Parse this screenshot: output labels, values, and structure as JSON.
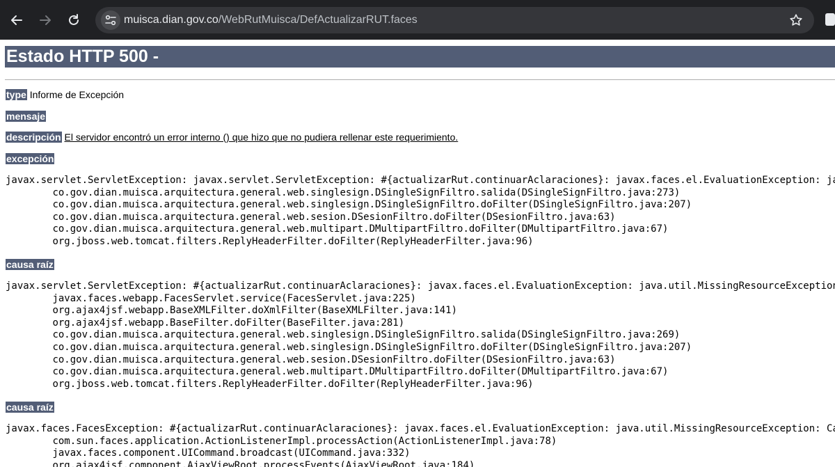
{
  "browser": {
    "url_host": "muisca.dian.gov.co",
    "url_path": "/WebRutMuisca/DefActualizarRUT.faces",
    "icons": {
      "back": "arrow-left-icon",
      "forward": "arrow-right-icon",
      "reload": "reload-icon",
      "site_info": "tune-icon",
      "bookmark": "star-icon"
    }
  },
  "page": {
    "title": "Estado HTTP 500 -",
    "type_label": "type",
    "type_value": "Informe de Excepción",
    "message_label": "mensaje",
    "description_label": "descripción",
    "description_value": "El servidor encontró un error interno () que hizo que no pudiera rellenar este requerimiento.",
    "exception_label": "excepción",
    "exception_trace": "javax.servlet.ServletException: javax.servlet.ServletException: #{actualizarRut.continuarAclaraciones}: javax.faces.el.EvaluationException: java.u\n\tco.gov.dian.muisca.arquitectura.general.web.singlesign.DSingleSignFiltro.salida(DSingleSignFiltro.java:273)\n\tco.gov.dian.muisca.arquitectura.general.web.singlesign.DSingleSignFiltro.doFilter(DSingleSignFiltro.java:207)\n\tco.gov.dian.muisca.arquitectura.general.web.sesion.DSesionFiltro.doFilter(DSesionFiltro.java:63)\n\tco.gov.dian.muisca.arquitectura.general.web.multipart.DMultipartFiltro.doFilter(DMultipartFiltro.java:67)\n\torg.jboss.web.tomcat.filters.ReplyHeaderFilter.doFilter(ReplyHeaderFilter.java:96)",
    "root_cause_label": "causa raíz",
    "root_cause_trace_1": "javax.servlet.ServletException: #{actualizarRut.continuarAclaraciones}: javax.faces.el.EvaluationException: java.util.MissingResourceException: Ca\n\tjavax.faces.webapp.FacesServlet.service(FacesServlet.java:225)\n\torg.ajax4jsf.webapp.BaseXMLFilter.doXmlFilter(BaseXMLFilter.java:141)\n\torg.ajax4jsf.webapp.BaseFilter.doFilter(BaseFilter.java:281)\n\tco.gov.dian.muisca.arquitectura.general.web.singlesign.DSingleSignFiltro.salida(DSingleSignFiltro.java:269)\n\tco.gov.dian.muisca.arquitectura.general.web.singlesign.DSingleSignFiltro.doFilter(DSingleSignFiltro.java:207)\n\tco.gov.dian.muisca.arquitectura.general.web.sesion.DSesionFiltro.doFilter(DSesionFiltro.java:63)\n\tco.gov.dian.muisca.arquitectura.general.web.multipart.DMultipartFiltro.doFilter(DMultipartFiltro.java:67)\n\torg.jboss.web.tomcat.filters.ReplyHeaderFilter.doFilter(ReplyHeaderFilter.java:96)",
    "root_cause_label_2": "causa raíz",
    "root_cause_trace_2": "javax.faces.FacesException: #{actualizarRut.continuarAclaraciones}: javax.faces.el.EvaluationException: java.util.MissingResourceException: Can't\n\tcom.sun.faces.application.ActionListenerImpl.processAction(ActionListenerImpl.java:78)\n\tjavax.faces.component.UICommand.broadcast(UICommand.java:332)\n\torg.ajax4jsf.component.AjaxViewRoot.processEvents(AjaxViewRoot.java:184)"
  },
  "colors": {
    "chrome_bg": "#202124",
    "omnibox_bg": "#35363a",
    "header_bg": "#525d76"
  }
}
